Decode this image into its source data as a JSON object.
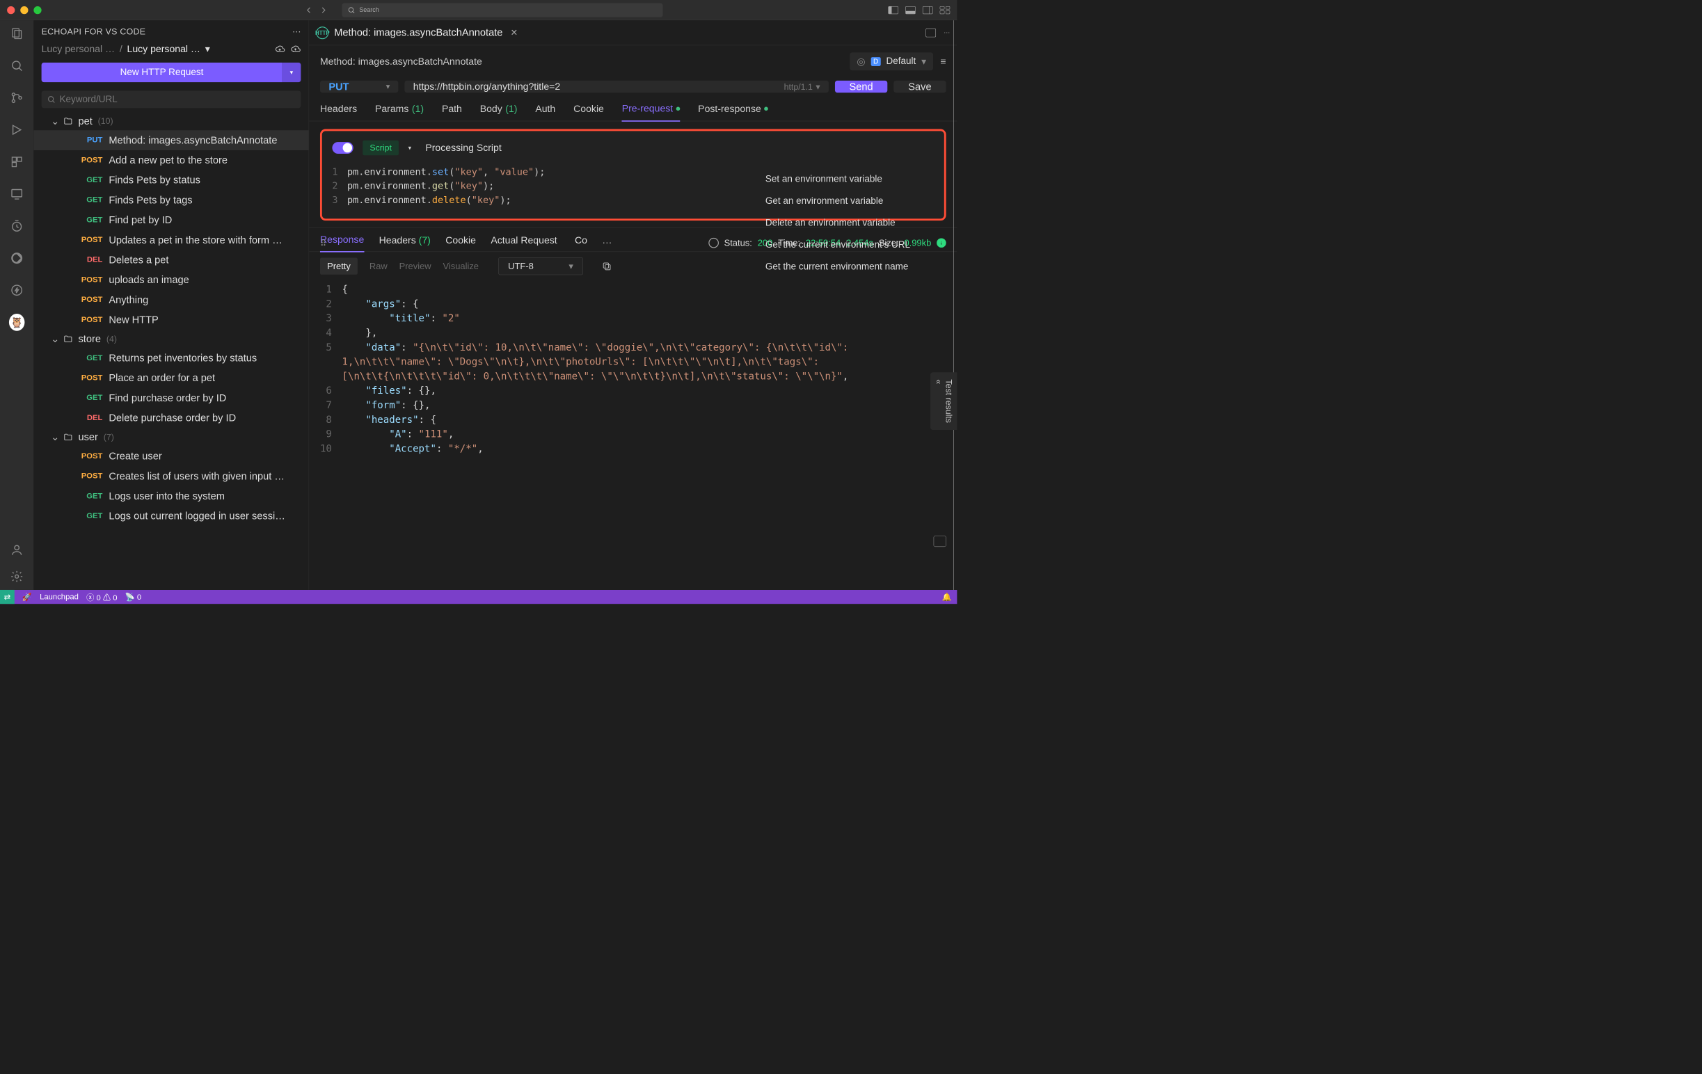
{
  "titlebar": {
    "search_placeholder": "Search"
  },
  "sidebar": {
    "title": "ECHOAPI FOR VS CODE",
    "crumb_parent": "Lucy personal …",
    "crumb_current": "Lucy personal …",
    "new_request": "New HTTP Request",
    "search_placeholder": "Keyword/URL",
    "groups": [
      {
        "name": "pet",
        "count": "(10)",
        "items": [
          {
            "method": "PUT",
            "label": "Method: images.asyncBatchAnnotate",
            "active": true
          },
          {
            "method": "POST",
            "label": "Add a new pet to the store"
          },
          {
            "method": "GET",
            "label": "Finds Pets by status"
          },
          {
            "method": "GET",
            "label": "Finds Pets by tags"
          },
          {
            "method": "GET",
            "label": "Find pet by ID"
          },
          {
            "method": "POST",
            "label": "Updates a pet in the store with form …"
          },
          {
            "method": "DEL",
            "label": "Deletes a pet"
          },
          {
            "method": "POST",
            "label": "uploads an image"
          },
          {
            "method": "POST",
            "label": "Anything"
          },
          {
            "method": "POST",
            "label": "New HTTP"
          }
        ]
      },
      {
        "name": "store",
        "count": "(4)",
        "items": [
          {
            "method": "GET",
            "label": "Returns pet inventories by status"
          },
          {
            "method": "POST",
            "label": "Place an order for a pet"
          },
          {
            "method": "GET",
            "label": "Find purchase order by ID"
          },
          {
            "method": "DEL",
            "label": "Delete purchase order by ID"
          }
        ]
      },
      {
        "name": "user",
        "count": "(7)",
        "items": [
          {
            "method": "POST",
            "label": "Create user"
          },
          {
            "method": "POST",
            "label": "Creates list of users with given input …"
          },
          {
            "method": "GET",
            "label": "Logs user into the system"
          },
          {
            "method": "GET",
            "label": "Logs out current logged in user sessi…"
          }
        ]
      }
    ]
  },
  "editor": {
    "tab_title": "Method: images.asyncBatchAnnotate",
    "breadcrumb": "Method: images.asyncBatchAnnotate",
    "env_label": "Default",
    "method": "PUT",
    "url": "https://httpbin.org/anything?title=2",
    "protocol": "http/1.1",
    "send": "Send",
    "save": "Save",
    "reqtabs": {
      "headers": "Headers",
      "params": "Params",
      "params_badge": "(1)",
      "path": "Path",
      "body": "Body",
      "body_badge": "(1)",
      "auth": "Auth",
      "cookie": "Cookie",
      "pre": "Pre-request",
      "post": "Post-response"
    },
    "script": {
      "badge": "Script",
      "title": "Processing Script",
      "lines": [
        "pm.environment.set(\"key\", \"value\");",
        "pm.environment.get(\"key\");",
        "pm.environment.delete(\"key\");"
      ],
      "helpers": [
        "Set an environment variable",
        "Get an environment variable",
        "Delete an environment variable",
        "Get the current environment's URL",
        "Get the current environment name"
      ]
    }
  },
  "response": {
    "tabs": {
      "response": "Response",
      "headers": "Headers",
      "headers_badge": "(7)",
      "cookie": "Cookie",
      "actual": "Actual Request",
      "co": "Co"
    },
    "status_label": "Status:",
    "status_code": "200",
    "time_label": "Time:",
    "time_clock": "22:59:54",
    "time_dur": "2.454s",
    "size_label": "Size:",
    "size_val": "0.99kb",
    "viewtabs": {
      "pretty": "Pretty",
      "raw": "Raw",
      "preview": "Preview",
      "visualize": "Visualize"
    },
    "encoding": "UTF-8",
    "json_lines": [
      "{",
      "    \"args\": {",
      "        \"title\": \"2\"",
      "    },",
      "    \"data\": \"{\\n\\t\\\"id\\\": 10,\\n\\t\\\"name\\\": \\\"doggie\\\",\\n\\t\\\"category\\\": {\\n\\t\\t\\\"id\\\": 1,\\n\\t\\t\\\"name\\\": \\\"Dogs\\\"\\n\\t},\\n\\t\\\"photoUrls\\\": [\\n\\t\\t\\\"\\\"\\n\\t],\\n\\t\\\"tags\\\": [\\n\\t\\t{\\n\\t\\t\\t\\\"id\\\": 0,\\n\\t\\t\\t\\\"name\\\": \\\"\\\"\\n\\t\\t}\\n\\t],\\n\\t\\\"status\\\": \\\"\\\"\\n}\",",
      "    \"files\": {},",
      "    \"form\": {},",
      "    \"headers\": {",
      "        \"A\": \"111\",",
      "        \"Accept\": \"*/*\","
    ],
    "test_results": "Test results"
  },
  "statusbar": {
    "launchpad": "Launchpad",
    "errors": "0",
    "warnings": "0",
    "ports": "0"
  }
}
